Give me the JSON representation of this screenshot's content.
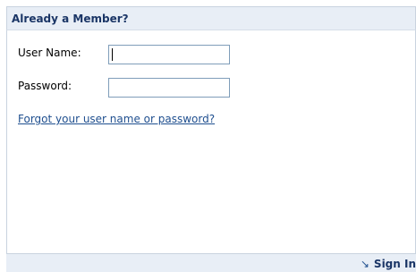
{
  "panel": {
    "title": "Already a Member?"
  },
  "form": {
    "username_label": "User Name:",
    "username_value": "",
    "password_label": "Password:",
    "password_value": "",
    "forgot_link": "Forgot your user name or password?"
  },
  "footer": {
    "signin_label": "Sign In",
    "signin_icon": "arrow-down-right-icon"
  },
  "colors": {
    "header_bg": "#e8eef6",
    "title_text": "#1a3566",
    "link": "#1f4f8f",
    "border": "#c9d3df"
  }
}
